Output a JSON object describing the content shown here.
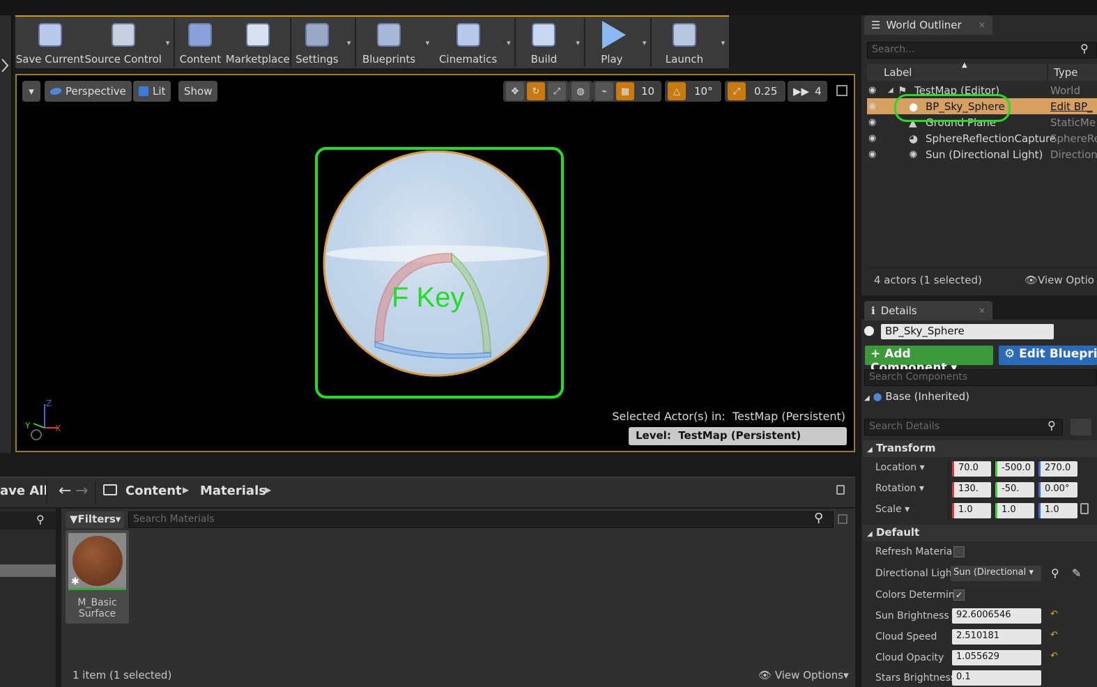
{
  "toolbar": {
    "items": [
      {
        "label": "Save Current",
        "icon": "save-icon",
        "dropdown": false
      },
      {
        "label": "Source Control",
        "icon": "source-control-icon",
        "dropdown": true
      },
      {
        "label": "Content",
        "icon": "content-icon",
        "dropdown": false
      },
      {
        "label": "Marketplace",
        "icon": "marketplace-icon",
        "dropdown": false
      },
      {
        "label": "Settings",
        "icon": "settings-icon",
        "dropdown": true
      },
      {
        "label": "Blueprints",
        "icon": "blueprints-icon",
        "dropdown": true
      },
      {
        "label": "Cinematics",
        "icon": "cinematics-icon",
        "dropdown": true
      },
      {
        "label": "Build",
        "icon": "build-icon",
        "dropdown": true
      },
      {
        "label": "Play",
        "icon": "play-icon",
        "dropdown": true
      },
      {
        "label": "Launch",
        "icon": "launch-icon",
        "dropdown": true
      }
    ]
  },
  "viewport": {
    "perspective_label": "Perspective",
    "lit_label": "Lit",
    "show_label": "Show",
    "grid_snap": "10",
    "rotation_snap": "10°",
    "scale_snap": "0.25",
    "camera_speed": "4",
    "annotation_text": "F Key",
    "selected_actors_label": "Selected Actor(s) in:",
    "selected_actors_value": "TestMap (Persistent)",
    "level_label": "Level:",
    "level_value": "TestMap (Persistent)",
    "axis_labels": {
      "x": "X",
      "y": "Y",
      "z": "Z"
    },
    "highlight_color": "#22dd22"
  },
  "content_browser": {
    "save_all_label": "ave All",
    "breadcrumb": [
      "Content",
      "Materials"
    ],
    "filters_label": "Filters",
    "search_placeholder": "Search Materials",
    "asset": {
      "name": "M_Basic Surface"
    },
    "status": "1 item (1 selected)",
    "view_options_label": "View Options"
  },
  "outliner": {
    "tab_label": "World Outliner",
    "search_placeholder": "Search...",
    "col_label": "Label",
    "col_type": "Type",
    "rows": [
      {
        "label": "TestMap (Editor)",
        "type": "World",
        "selected": false
      },
      {
        "label": "BP_Sky_Sphere",
        "type": "Edit BP_",
        "selected": true
      },
      {
        "label": "Ground Plane",
        "type": "StaticMe",
        "selected": false
      },
      {
        "label": "SphereReflectionCapture",
        "type": "SphereRe",
        "selected": false
      },
      {
        "label": "Sun (Directional Light)",
        "type": "Direction",
        "selected": false
      }
    ],
    "status": "4 actors (1 selected)",
    "view_options_label": "View Optio"
  },
  "details": {
    "tab_label": "Details",
    "actor_name": "BP_Sky_Sphere",
    "add_component_label": "Add Component",
    "edit_blueprint_label": "Edit Bluepri",
    "search_components_placeholder": "Search Components",
    "base_inherited_label": "Base (Inherited)",
    "search_details_placeholder": "Search Details",
    "transform_label": "Transform",
    "location_label": "Location",
    "location": [
      "70.0",
      "-500.0",
      "270.0"
    ],
    "rotation_label": "Rotation",
    "rotation": [
      "130.",
      "-50.",
      "0.00°"
    ],
    "scale_label": "Scale",
    "scale": [
      "1.0",
      "1.0",
      "1.0"
    ],
    "default_label": "Default",
    "refresh_material_label": "Refresh Materia",
    "directional_light_label": "Directional Ligh",
    "directional_light_value": "Sun (Directional",
    "colors_determined_label": "Colors Determin",
    "sun_brightness_label": "Sun Brightness",
    "sun_brightness": "92.6006546",
    "cloud_speed_label": "Cloud Speed",
    "cloud_speed": "2.510181",
    "cloud_opacity_label": "Cloud Opacity",
    "cloud_opacity": "1.055629",
    "stars_brightness_label": "Stars Brightness",
    "stars_brightness": "0.1"
  }
}
